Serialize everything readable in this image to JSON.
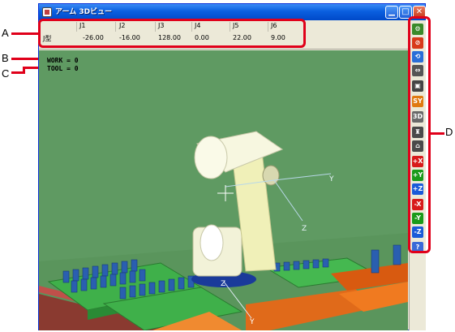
{
  "window": {
    "title": "アーム 3Dビュー"
  },
  "titlebar_buttons": {
    "minimize": "▁",
    "maximize": "□",
    "close": "✕"
  },
  "joint_panel": {
    "headers": [
      "J1",
      "J2",
      "J3",
      "J4",
      "J5",
      "J6"
    ],
    "row_label": "J型",
    "values": [
      "-26.00",
      "-16.00",
      "128.00",
      "0.00",
      "22.00",
      "9.00"
    ]
  },
  "status": {
    "work": "WORK = 0",
    "tool": "TOOL = 0"
  },
  "axis_labels": {
    "tool_y": "Y",
    "tool_z": "Z",
    "base_z": "Z",
    "base_y": "Y"
  },
  "toolbar": {
    "buttons": [
      {
        "name": "robot-view-icon",
        "label": "",
        "color": "#3a8a2a"
      },
      {
        "name": "no-entry-icon",
        "label": "",
        "color": "#d83a1a"
      },
      {
        "name": "rotate-icon",
        "label": "",
        "color": "#2a6ed8"
      },
      {
        "name": "move-arrows-icon",
        "label": "",
        "color": "#555555"
      },
      {
        "name": "camera-icon",
        "label": "",
        "color": "#444444"
      },
      {
        "name": "sync-icon",
        "label": "SY",
        "color": "#e07a10"
      },
      {
        "name": "view-3d-icon",
        "label": "3D",
        "color": "#6a6a6a"
      },
      {
        "name": "robot-pose-icon",
        "label": "",
        "color": "#4a4a4a"
      },
      {
        "name": "home-icon",
        "label": "",
        "color": "#4a4a4a"
      },
      {
        "name": "x-plus-icon",
        "label": "+X",
        "color": "#d81a1a"
      },
      {
        "name": "y-plus-icon",
        "label": "+Y",
        "color": "#1a9a1a"
      },
      {
        "name": "z-plus-icon",
        "label": "+Z",
        "color": "#1a5ad8"
      },
      {
        "name": "x-minus-icon",
        "label": "-X",
        "color": "#d81a1a"
      },
      {
        "name": "y-minus-icon",
        "label": "-Y",
        "color": "#1a9a1a"
      },
      {
        "name": "z-minus-icon",
        "label": "-Z",
        "color": "#1a5ad8"
      },
      {
        "name": "help-icon",
        "label": "?",
        "color": "#3a6ad8"
      }
    ]
  },
  "callouts": {
    "a": "A",
    "b": "B",
    "c": "C",
    "d": "D"
  },
  "colors": {
    "scene_background": "#5f9a62",
    "callout": "#e0001a",
    "titlebar": "#0a5fdf"
  }
}
